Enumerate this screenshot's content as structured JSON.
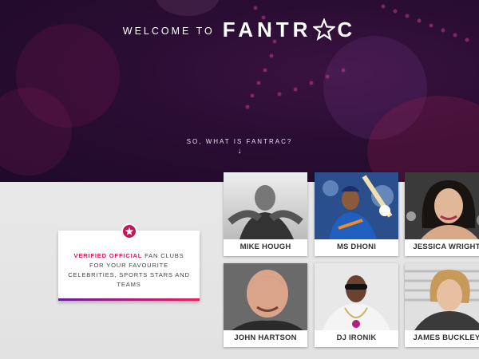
{
  "hero": {
    "welcome": "WELCOME TO",
    "brand_left": "FANTR",
    "brand_right": "C",
    "question": "SO, WHAT IS FANTRAC?",
    "arrow": "↓"
  },
  "info_card": {
    "highlight": "VERIFIED OFFICIAL",
    "text": " FAN CLUBS FOR YOUR FAVOURITE CELEBRITIES, SPORTS STARS AND TEAMS",
    "badge_icon": "star-icon"
  },
  "celebrities": [
    {
      "name": "MIKE HOUGH"
    },
    {
      "name": "MS DHONI"
    },
    {
      "name": "JESSICA WRIGHT"
    },
    {
      "name": "JOHN HARTSON"
    },
    {
      "name": "DJ IRONIK"
    },
    {
      "name": "JAMES BUCKLEY"
    }
  ],
  "colors": {
    "hero_bg": "#2a0d33",
    "accent": "#d81b60",
    "accent_purple": "#6a1b9a"
  }
}
